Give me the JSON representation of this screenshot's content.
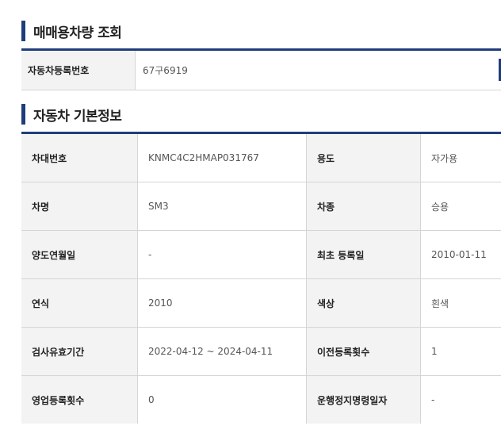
{
  "search_section": {
    "title": "매매용차량 조회",
    "label": "자동차등록번호",
    "value": "67구6919"
  },
  "info_section": {
    "title": "자동차 기본정보",
    "rows": [
      {
        "label1": "차대번호",
        "value1": "KNMC4C2HMAP031767",
        "label2": "용도",
        "value2": "자가용"
      },
      {
        "label1": "차명",
        "value1": "SM3",
        "label2": "차종",
        "value2": "승용"
      },
      {
        "label1": "양도연월일",
        "value1": "-",
        "label2": "최초 등록일",
        "value2": "2010-01-11"
      },
      {
        "label1": "연식",
        "value1": "2010",
        "label2": "색상",
        "value2": "흰색"
      },
      {
        "label1": "검사유효기간",
        "value1": "2022-04-12 ~ 2024-04-11",
        "label2": "이전등록횟수",
        "value2": "1"
      },
      {
        "label1": "영업등록횟수",
        "value1": "0",
        "label2": "운행정지명령일자",
        "value2": "-"
      }
    ]
  },
  "colors": {
    "accent": "#1f3d7a",
    "header_bg": "#f3f3f3",
    "border": "#d5d5d5"
  }
}
